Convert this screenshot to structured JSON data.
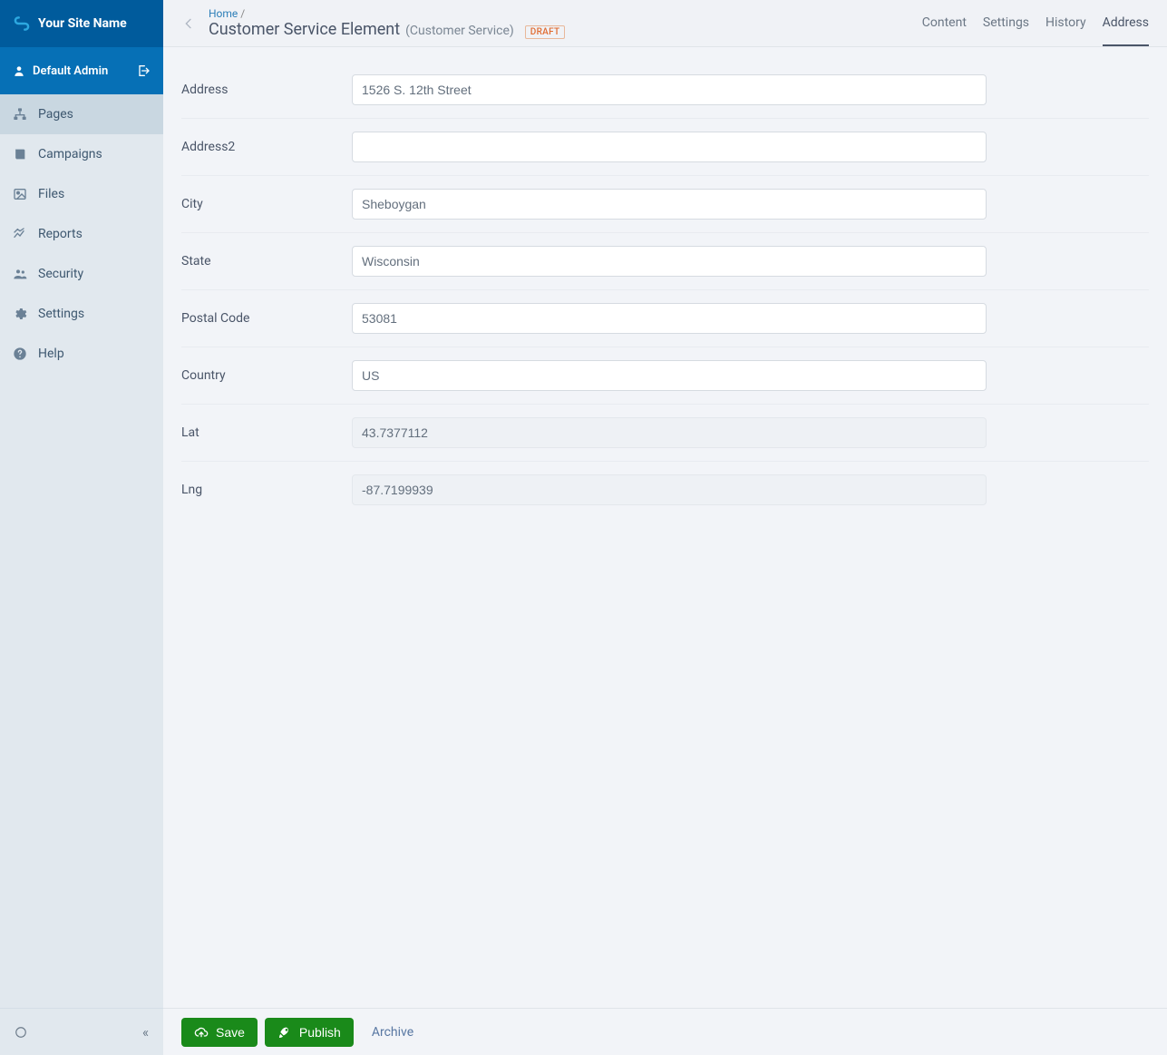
{
  "brand": {
    "name": "Your Site Name"
  },
  "user": {
    "name": "Default Admin"
  },
  "sidebar": {
    "items": [
      {
        "label": "Pages"
      },
      {
        "label": "Campaigns"
      },
      {
        "label": "Files"
      },
      {
        "label": "Reports"
      },
      {
        "label": "Security"
      },
      {
        "label": "Settings"
      },
      {
        "label": "Help"
      }
    ]
  },
  "breadcrumb": {
    "home": "Home",
    "sep": "/"
  },
  "page": {
    "title": "Customer Service Element",
    "subtype": "(Customer Service)",
    "badge": "DRAFT"
  },
  "tabs": [
    {
      "label": "Content"
    },
    {
      "label": "Settings"
    },
    {
      "label": "History"
    },
    {
      "label": "Address"
    }
  ],
  "form": {
    "address": {
      "label": "Address",
      "value": "1526 S. 12th Street"
    },
    "address2": {
      "label": "Address2",
      "value": ""
    },
    "city": {
      "label": "City",
      "value": "Sheboygan"
    },
    "state": {
      "label": "State",
      "value": "Wisconsin"
    },
    "postal": {
      "label": "Postal Code",
      "value": "53081"
    },
    "country": {
      "label": "Country",
      "value": "US"
    },
    "lat": {
      "label": "Lat",
      "value": "43.7377112"
    },
    "lng": {
      "label": "Lng",
      "value": "-87.7199939"
    }
  },
  "footer": {
    "save": "Save",
    "publish": "Publish",
    "archive": "Archive"
  }
}
